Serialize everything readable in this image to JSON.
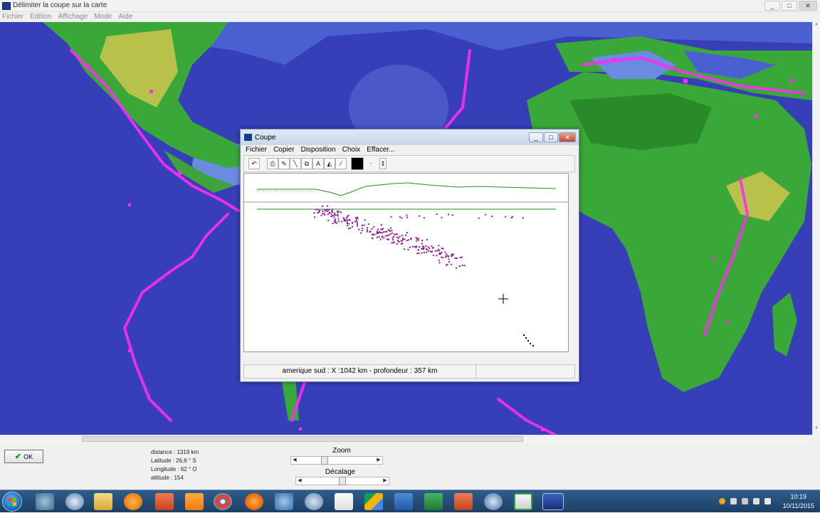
{
  "window": {
    "title": "Délimiter la coupe sur la carte",
    "min": "_",
    "max": "□",
    "close": "✕"
  },
  "menubar": [
    "Fichier",
    "Edition",
    "Affichage",
    "Mode",
    "Aide"
  ],
  "coupe": {
    "title": "Coupe",
    "menu": [
      "Fichier",
      "Copier",
      "Disposition",
      "Choix",
      "Effacer..."
    ],
    "status": "amerique sud : X :1042 km  - profondeur : 357 km"
  },
  "bottom": {
    "ok_label": "OK",
    "info": {
      "distance": "distance : 1319 km",
      "latitude": "Latitude : 26,6 ° S",
      "longitude": "Longitude : 62 ° O",
      "altitude": "altitude : 154"
    },
    "zoom_label": "Zoom",
    "decalage_label": "Décalage"
  },
  "taskbar": {
    "time": "10:19",
    "date": "10/11/2015"
  },
  "colors": {
    "quake": "#ff2cf2",
    "section": "#8c1a8c",
    "relief": "#2a8a2a"
  }
}
